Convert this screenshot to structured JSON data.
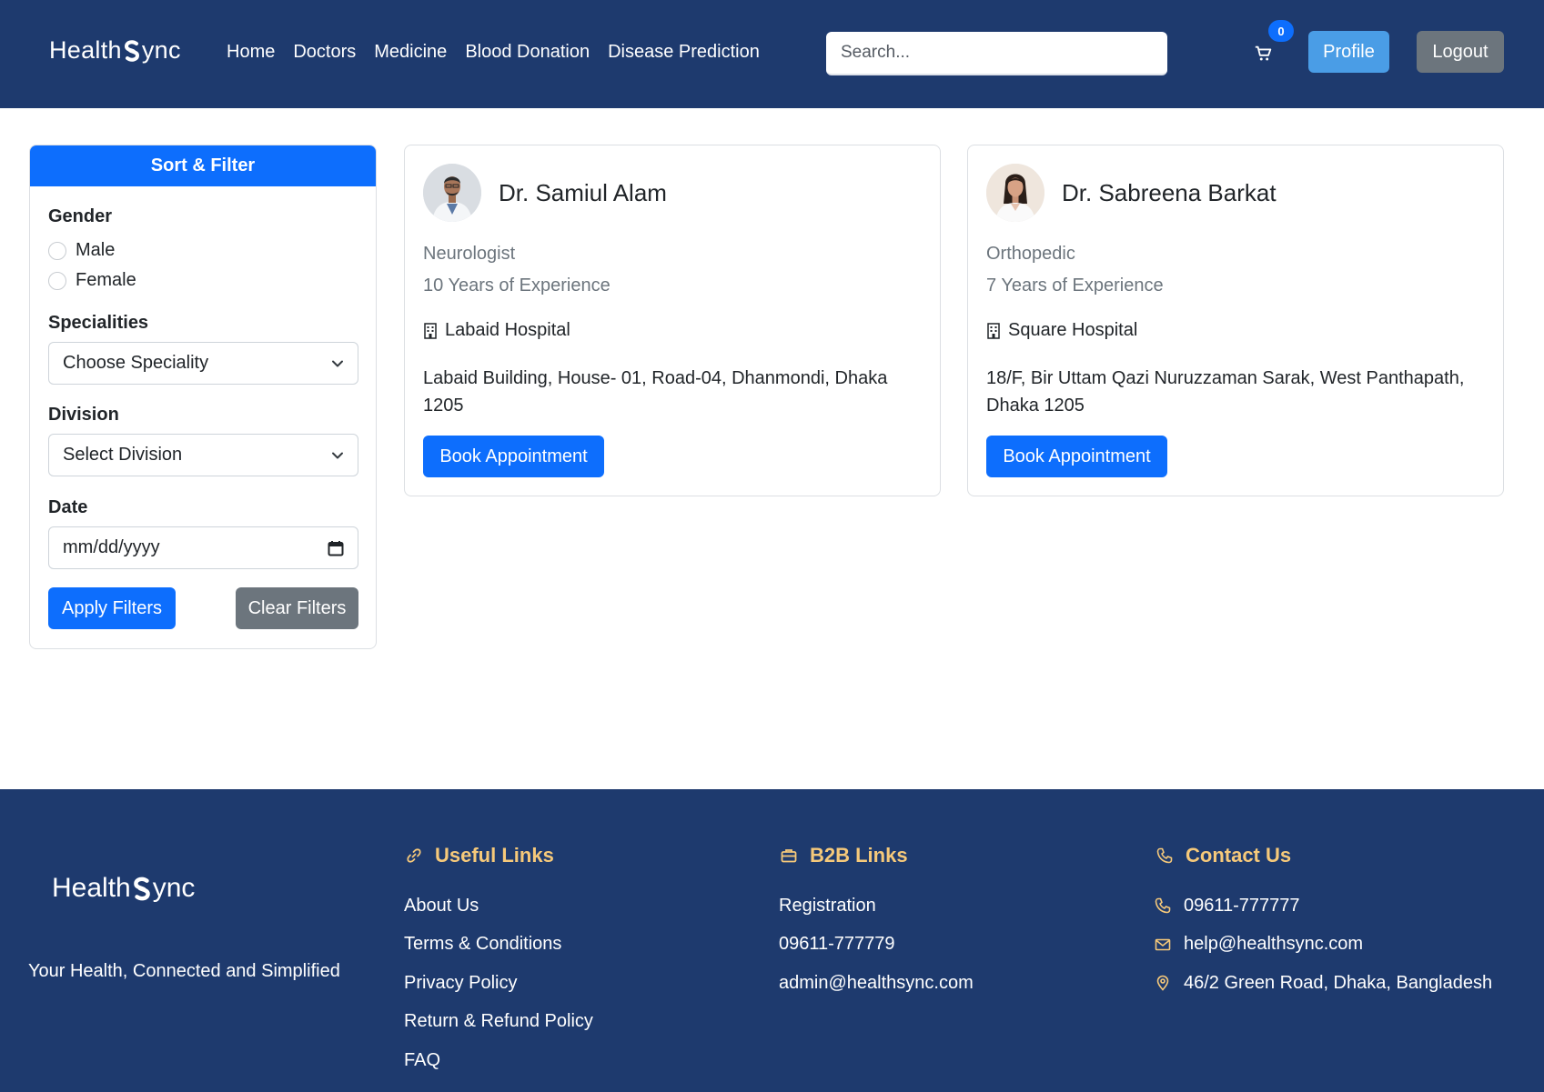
{
  "brand": {
    "name_left": "Health",
    "name_right": "ync"
  },
  "nav": {
    "links": [
      "Home",
      "Doctors",
      "Medicine",
      "Blood Donation",
      "Disease Prediction"
    ],
    "search_placeholder": "Search...",
    "cart_count": "0",
    "profile_label": "Profile",
    "logout_label": "Logout"
  },
  "filter": {
    "title": "Sort & Filter",
    "gender_label": "Gender",
    "gender_options": [
      "Male",
      "Female"
    ],
    "speciality_label": "Specialities",
    "speciality_value": "Choose Speciality",
    "division_label": "Division",
    "division_value": "Select Division",
    "date_label": "Date",
    "date_placeholder": "mm/dd/yyyy",
    "apply_label": "Apply Filters",
    "clear_label": "Clear Filters"
  },
  "doctors": [
    {
      "name": "Dr. Samiul Alam",
      "specialty": "Neurologist",
      "experience": "10 Years of Experience",
      "hospital": "Labaid Hospital",
      "address": "Labaid Building, House- 01, Road-04, Dhanmondi, Dhaka 1205",
      "book_label": "Book Appointment"
    },
    {
      "name": "Dr. Sabreena Barkat",
      "specialty": "Orthopedic",
      "experience": "7 Years of Experience",
      "hospital": "Square Hospital",
      "address": "18/F, Bir Uttam Qazi Nuruzzaman Sarak, West Panthapath, Dhaka 1205",
      "book_label": "Book Appointment"
    }
  ],
  "footer": {
    "tagline": "Your Health, Connected and Simplified",
    "useful_title": "Useful Links",
    "useful_links": [
      "About Us",
      "Terms & Conditions",
      "Privacy Policy",
      "Return & Refund Policy",
      "FAQ"
    ],
    "b2b_title": "B2B Links",
    "b2b_links": [
      "Registration",
      "09611-777779",
      "admin@healthsync.com"
    ],
    "contact_title": "Contact Us",
    "contact_phone": "09611-777777",
    "contact_email": "help@healthsync.com",
    "contact_address": "46/2 Green Road, Dhaka, Bangladesh"
  },
  "colors": {
    "navy": "#1e3a6e",
    "primary": "#0d6efd",
    "accent_gold": "#f6c97a",
    "secondary": "#6c757d"
  },
  "icons": [
    "cart-icon",
    "chevron-down-icon",
    "calendar-icon",
    "hospital-icon",
    "link-icon",
    "briefcase-icon",
    "phone-icon",
    "envelope-icon",
    "location-pin-icon"
  ]
}
